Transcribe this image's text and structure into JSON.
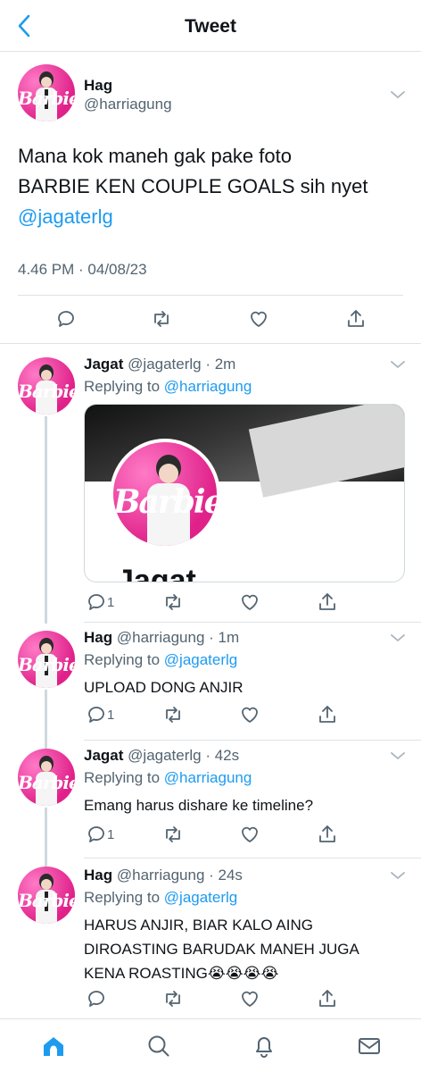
{
  "header": {
    "title": "Tweet"
  },
  "main_tweet": {
    "name": "Hag",
    "handle": "@harriagung",
    "text_line1": "Mana kok maneh gak pake foto",
    "text_line2": "BARBIE KEN COUPLE GOALS sih nyet",
    "mention": "@jagaterlg",
    "timestamp": "4.46 PM · 04/08/23"
  },
  "avatar_wordmark": "Barbie",
  "replies": [
    {
      "name": "Jagat",
      "meta": "@jagaterlg · 2m",
      "replying_prefix": "Replying to ",
      "replying_to": "@harriagung",
      "card_name": "Jagat",
      "reply_count": "1"
    },
    {
      "name": "Hag",
      "meta": "@harriagung · 1m",
      "replying_prefix": "Replying to ",
      "replying_to": "@jagaterlg",
      "text": "UPLOAD DONG ANJIR",
      "reply_count": "1"
    },
    {
      "name": "Jagat",
      "meta": "@jagaterlg · 42s",
      "replying_prefix": "Replying to ",
      "replying_to": "@harriagung",
      "text": "Emang harus dishare ke timeline?",
      "reply_count": "1"
    },
    {
      "name": "Hag",
      "meta": "@harriagung · 24s",
      "replying_prefix": "Replying to ",
      "replying_to": "@jagaterlg",
      "text_line1": "HARUS ANJIR, BIAR KALO AING",
      "text_line2": "DIROASTING BARUDAK MANEH JUGA",
      "text_line3": "KENA ROASTING😭😭😭😭"
    }
  ],
  "colors": {
    "accent": "#1d9bf0",
    "barbie_pink": "#e0218a",
    "muted": "#536471"
  },
  "icons": [
    "back-arrow-icon",
    "chevron-down-icon",
    "reply-icon",
    "retweet-icon",
    "like-icon",
    "share-icon",
    "home-icon",
    "search-icon",
    "notifications-icon",
    "messages-icon"
  ]
}
